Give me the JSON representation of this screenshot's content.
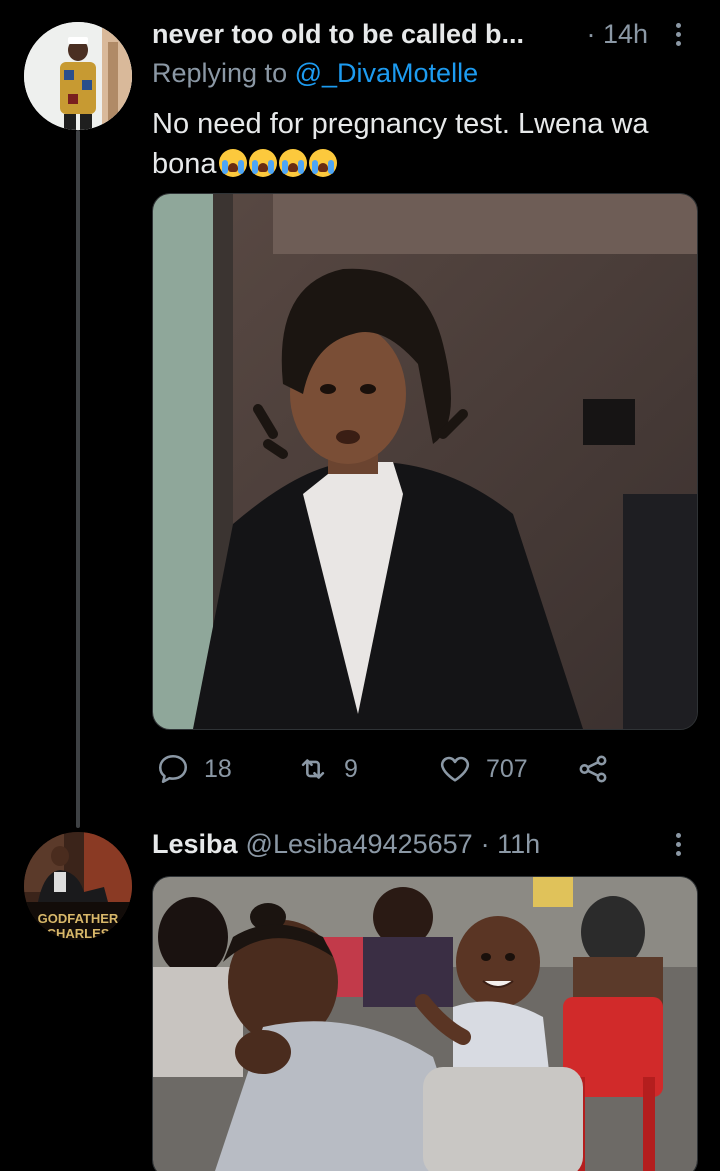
{
  "tweets": [
    {
      "display_name": "never too old to be called b...",
      "time": "· 14h",
      "replying_prefix": "Replying to",
      "replying_handle": "@_DivaMotelle",
      "text_line1": "No need for pregnancy test. Lwena wa",
      "text_line2": "bona",
      "emoji": [
        "loudly-crying-face",
        "loudly-crying-face",
        "loudly-crying-face",
        "loudly-crying-face"
      ],
      "replies": "18",
      "retweets": "9",
      "likes": "707"
    },
    {
      "display_name": "Lesiba",
      "handle": "@Lesiba49425657",
      "time": "· 11h",
      "avatar_text_1": "GODFATHER",
      "avatar_text_2": "CHARLES"
    }
  ],
  "colors": {
    "background": "#000000",
    "text": "#e7e9ea",
    "muted": "#8b98a5",
    "link": "#1d9bf0",
    "thread_line": "#3e4144"
  }
}
